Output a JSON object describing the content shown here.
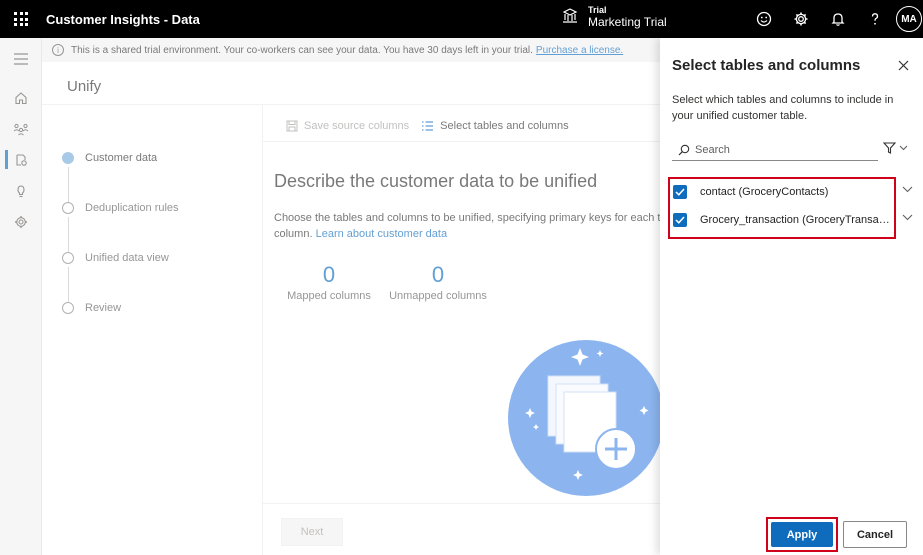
{
  "app": {
    "title": "Customer Insights - Data",
    "environment_type": "Trial",
    "environment_name": "Marketing Trial",
    "user_initials": "MA",
    "icons": [
      "waffle-icon",
      "environment-icon",
      "smiley-icon",
      "gear-icon",
      "bell-icon",
      "help-icon"
    ]
  },
  "nav": {
    "items": [
      "menu",
      "home",
      "segments",
      "data",
      "insights",
      "settings"
    ],
    "active": "data"
  },
  "banner": {
    "text": "This is a shared trial environment. Your co-workers can see your data. You have 30 days left in your trial.",
    "link": "Purchase a license."
  },
  "page": {
    "title": "Unify",
    "steps": [
      {
        "label": "Customer data",
        "current": true
      },
      {
        "label": "Deduplication rules",
        "current": false
      },
      {
        "label": "Unified data view",
        "current": false
      },
      {
        "label": "Review",
        "current": false
      }
    ],
    "commands": {
      "save": "Save source columns",
      "select": "Select tables and columns"
    },
    "heading": "Describe the customer data to be unified",
    "description_line1": "Choose the tables and columns to be unified, specifying primary keys for each t",
    "description_line2": "column.",
    "learn_link": "Learn about customer data",
    "mapped": {
      "value": "0",
      "label": "Mapped columns"
    },
    "unmapped": {
      "value": "0",
      "label": "Unmapped columns"
    },
    "next": "Next"
  },
  "panel": {
    "title": "Select tables and columns",
    "description": "Select which tables and columns to include in your unified customer table.",
    "search_placeholder": "Search",
    "tables": [
      {
        "label": "contact (GroceryContacts)",
        "checked": true
      },
      {
        "label": "Grocery_transaction (GroceryTransactions)",
        "checked": true
      }
    ],
    "apply": "Apply",
    "cancel": "Cancel"
  },
  "colors": {
    "accent": "#0f6cbd",
    "highlight": "#d0021b",
    "topbar": "#000000"
  }
}
